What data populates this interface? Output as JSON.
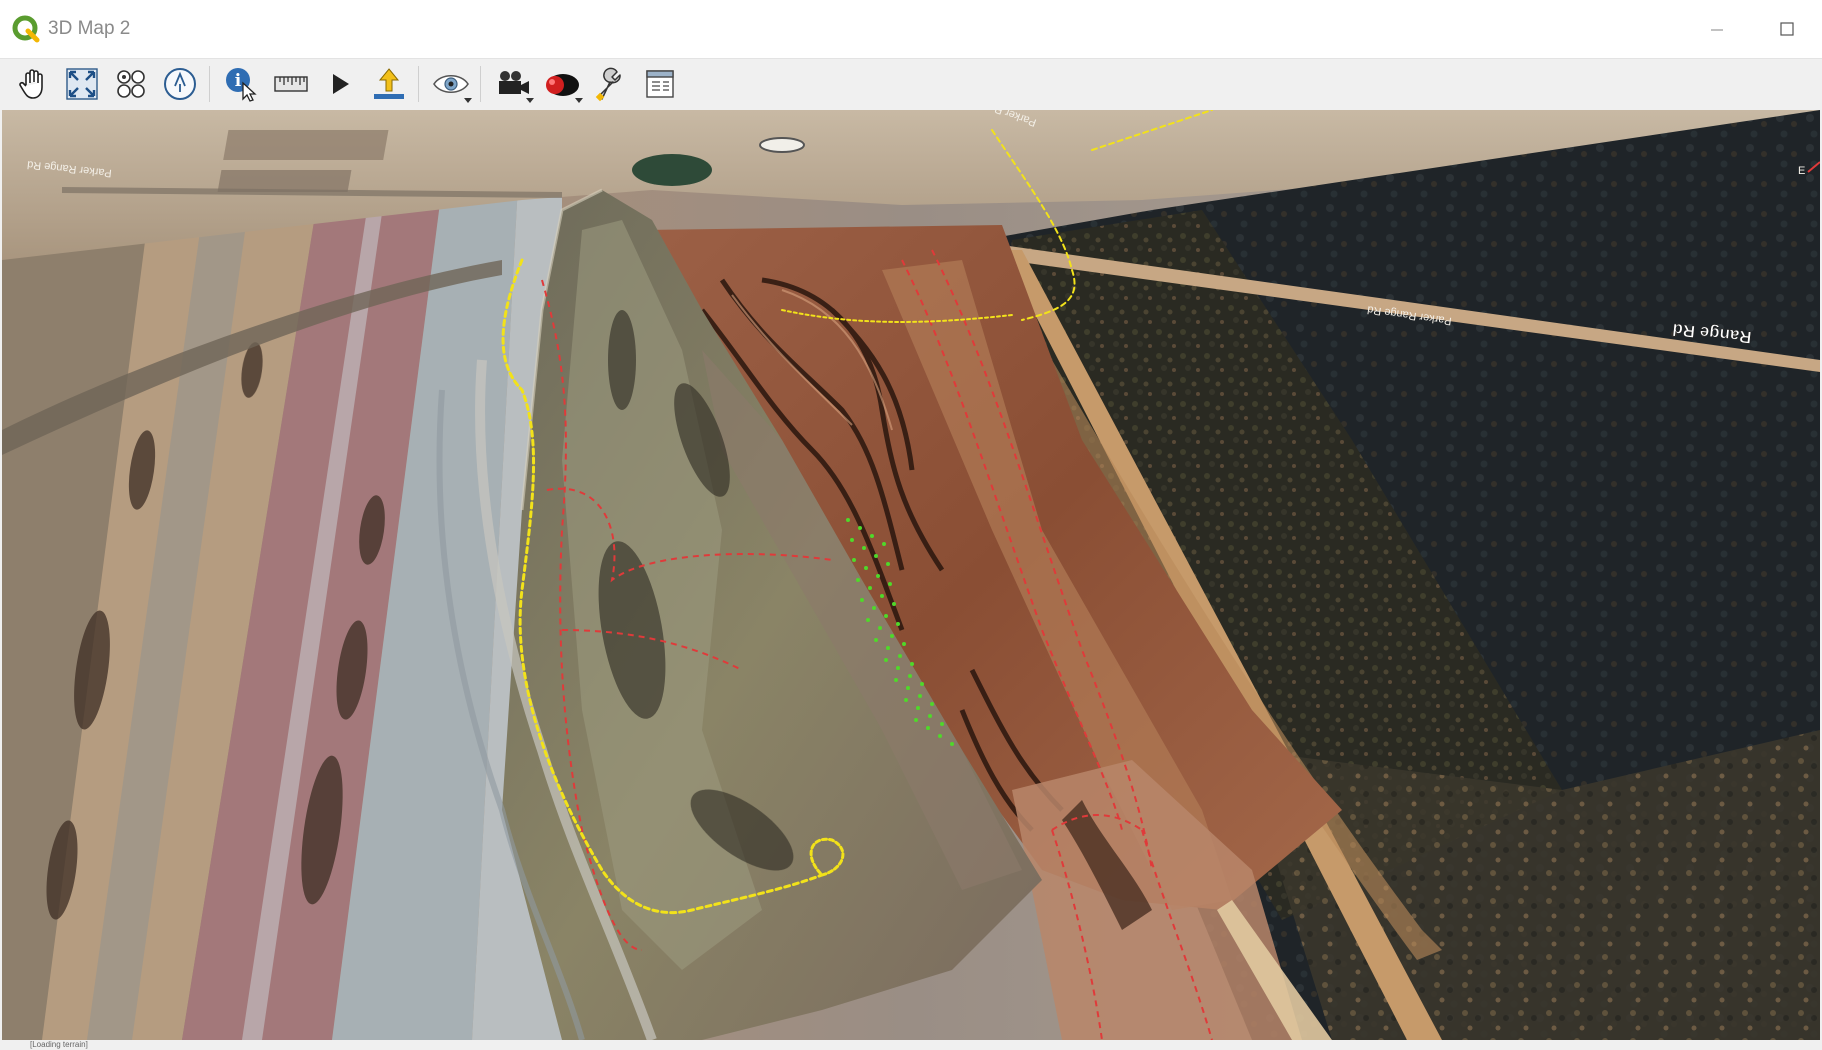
{
  "window": {
    "title": "3D Map 2",
    "minimize_icon": "minimize-icon",
    "maximize_icon": "maximize-icon"
  },
  "toolbar": {
    "tools": [
      {
        "name": "pan-tool",
        "icon": "hand-icon"
      },
      {
        "name": "zoom-full-tool",
        "icon": "zoom-full-icon"
      },
      {
        "name": "toggle-on-screen-nav-tool",
        "icon": "nav-controls-icon"
      },
      {
        "name": "reset-north-tool",
        "icon": "compass-icon"
      },
      {
        "name": "identify-tool",
        "icon": "identify-icon"
      },
      {
        "name": "measure-line-tool",
        "icon": "ruler-icon"
      },
      {
        "name": "animations-tool",
        "icon": "play-icon"
      },
      {
        "name": "export-3d-scene-tool",
        "icon": "export-icon"
      },
      {
        "name": "camera-view-tool",
        "icon": "eye-icon"
      },
      {
        "name": "camera-tool",
        "icon": "video-camera-icon"
      },
      {
        "name": "effects-tool",
        "icon": "shading-icon"
      },
      {
        "name": "configure-tool",
        "icon": "wrench-icon"
      },
      {
        "name": "layout-tool",
        "icon": "layout-icon"
      }
    ]
  },
  "map": {
    "road_labels": [
      "Range Rd",
      "Parker Range Rd",
      "Parker Range Rd",
      "Parker Range Rd"
    ],
    "compass_label": "E",
    "colors": {
      "yellow_trail": "#f2e21a",
      "red_boundary": "#e03a3a",
      "green_points": "#4fd82a"
    }
  },
  "status": {
    "text": "[Loading terrain]"
  }
}
